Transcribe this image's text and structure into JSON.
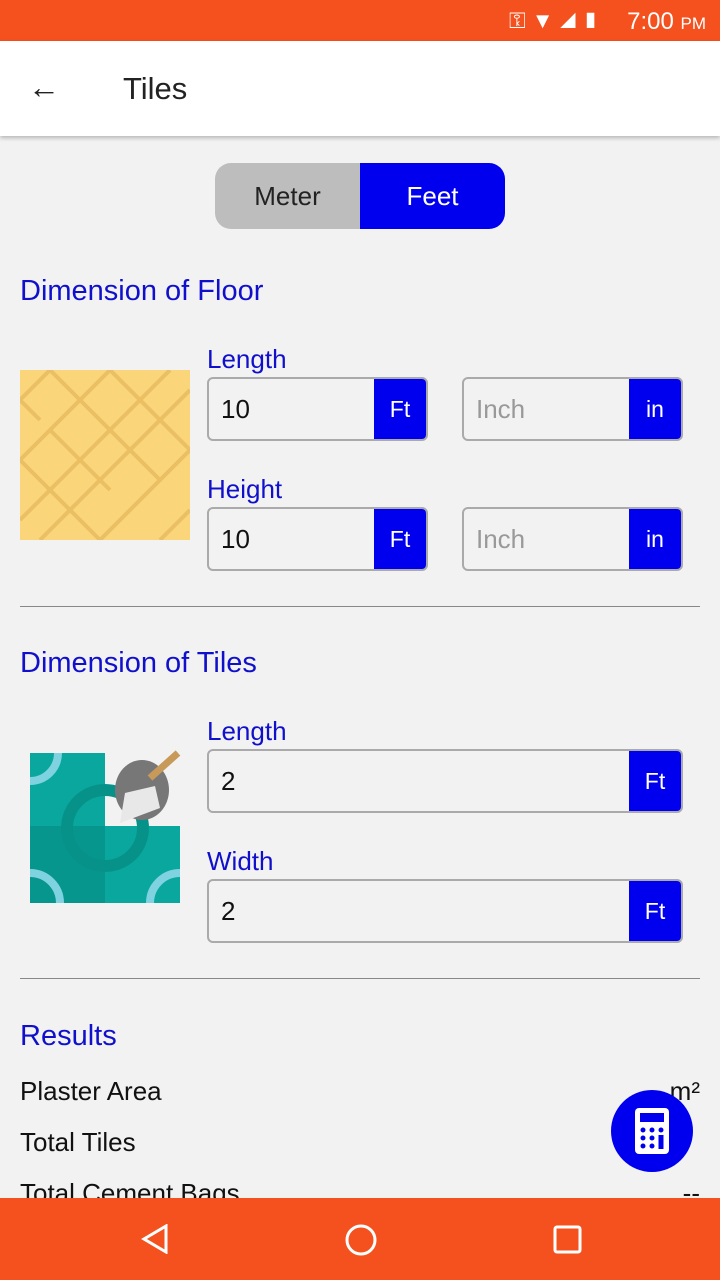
{
  "status": {
    "time": "7:00",
    "ampm": "PM"
  },
  "appbar": {
    "title": "Tiles"
  },
  "unit_toggle": {
    "options": [
      "Meter",
      "Feet"
    ],
    "selected": "Feet"
  },
  "floor": {
    "heading": "Dimension of Floor",
    "length": {
      "label": "Length",
      "value": "10",
      "unit": "Ft",
      "inch_placeholder": "Inch",
      "inch_unit": "in"
    },
    "height": {
      "label": "Height",
      "value": "10",
      "unit": "Ft",
      "inch_placeholder": "Inch",
      "inch_unit": "in"
    }
  },
  "tiles": {
    "heading": "Dimension of Tiles",
    "length": {
      "label": "Length",
      "value": "2",
      "unit": "Ft"
    },
    "width": {
      "label": "Width",
      "value": "2",
      "unit": "Ft"
    }
  },
  "results": {
    "heading": "Results",
    "rows": [
      {
        "label": "Plaster Area",
        "value": "m²"
      },
      {
        "label": "Total Tiles",
        "value": ""
      },
      {
        "label": "Total Cement Bags",
        "value": "--"
      }
    ]
  },
  "colors": {
    "accent": "#0000ee",
    "statusbar": "#f4511e"
  }
}
